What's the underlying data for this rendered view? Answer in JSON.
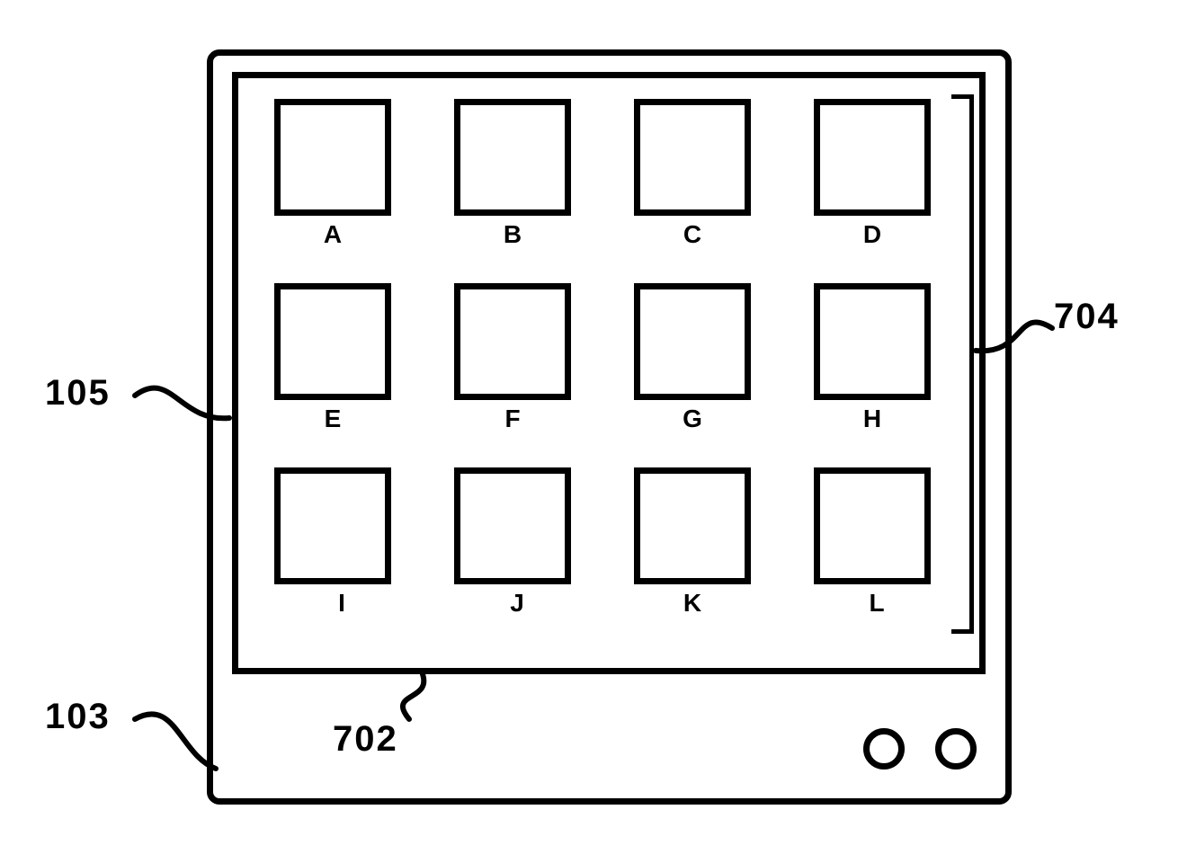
{
  "diagram": {
    "cells": {
      "a": "A",
      "b": "B",
      "c": "C",
      "d": "D",
      "e": "E",
      "f": "F",
      "g": "G",
      "h": "H",
      "i": "I",
      "j": "J",
      "k": "K",
      "l": "L"
    },
    "refs": {
      "r105": "105",
      "r103": "103",
      "r702": "702",
      "r704": "704"
    }
  }
}
